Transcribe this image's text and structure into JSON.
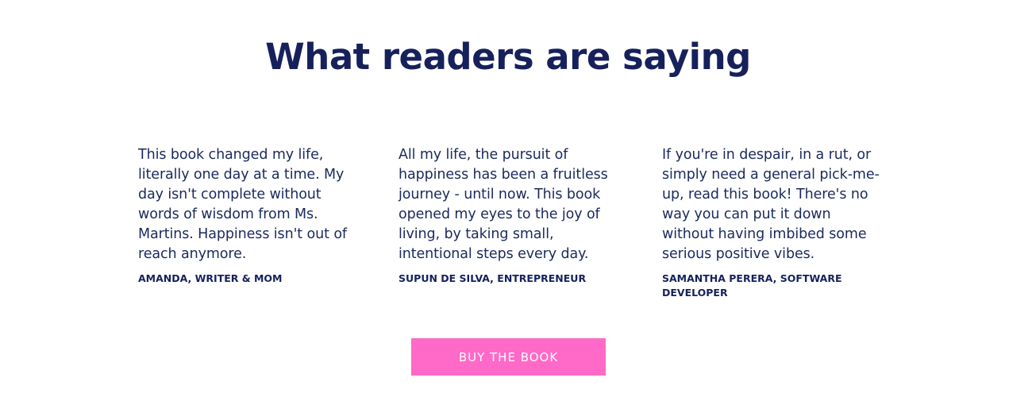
{
  "section": {
    "title": "What readers are saying"
  },
  "testimonials": [
    {
      "quote": "This book changed my life, literally one day at a time. My day isn't complete without words of wisdom from Ms. Martins. Happiness isn't out of reach anymore.",
      "author": "AMANDA, WRITER & MOM"
    },
    {
      "quote": "All my life, the pursuit of happiness has been a fruitless journey - until now. This book opened my eyes to the joy of living, by taking small, intentional steps every day.",
      "author": "SUPUN DE SILVA, ENTREPRENEUR"
    },
    {
      "quote": "If you're in despair, in a rut, or simply need a general pick-me-up, read this book! There's no way you can put it down without having imbibed some serious positive vibes.",
      "author": "SAMANTHA PERERA, SOFTWARE DEVELOPER"
    }
  ],
  "cta": {
    "label": "BUY THE BOOK"
  },
  "colors": {
    "heading": "#16215c",
    "text": "#1a2a5c",
    "accent": "#ff69c8",
    "background": "#ffffff"
  }
}
